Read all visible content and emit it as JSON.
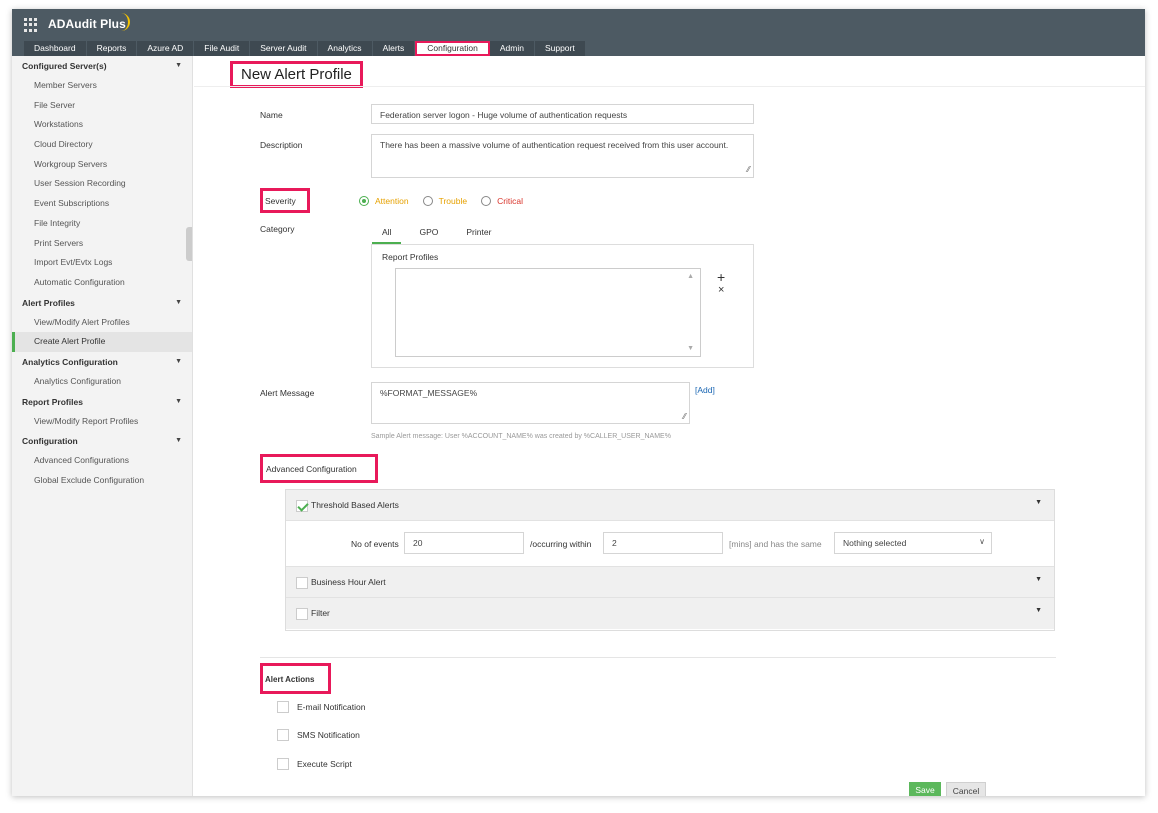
{
  "app": {
    "title": "ADAudit Plus"
  },
  "tabs": [
    "Dashboard",
    "Reports",
    "Azure AD",
    "File Audit",
    "Server Audit",
    "Analytics",
    "Alerts",
    "Configuration",
    "Admin",
    "Support"
  ],
  "active_tab": "Configuration",
  "sidebar": {
    "sections": [
      {
        "title": "Configured Server(s)",
        "items": [
          "Member Servers",
          "File Server",
          "Workstations",
          "Cloud Directory",
          "Workgroup Servers",
          "User Session Recording",
          "Event Subscriptions",
          "File Integrity",
          "Print Servers",
          "Import Evt/Evtx Logs",
          "Automatic Configuration"
        ]
      },
      {
        "title": "Alert Profiles",
        "items": [
          "View/Modify Alert Profiles",
          "Create Alert Profile"
        ]
      },
      {
        "title": "Analytics Configuration",
        "items": [
          "Analytics Configuration"
        ]
      },
      {
        "title": "Report Profiles",
        "items": [
          "View/Modify Report Profiles"
        ]
      },
      {
        "title": "Configuration",
        "items": [
          "Advanced Configurations",
          "Global Exclude Configuration"
        ]
      }
    ],
    "active_item": "Create Alert Profile"
  },
  "page": {
    "title": "New Alert Profile",
    "name_label": "Name",
    "name_value": "Federation server logon - Huge volume of authentication requests",
    "description_label": "Description",
    "description_value": "There has been a massive volume of authentication request received from this user account.",
    "severity_label": "Severity",
    "severity_options": [
      "Attention",
      "Trouble",
      "Critical"
    ],
    "severity_colors": [
      "#e6a100",
      "#e6a100",
      "#d9342b"
    ],
    "severity_selected": "Attention",
    "category_label": "Category",
    "category_tabs": [
      "All",
      "GPO",
      "Printer"
    ],
    "category_active": "All",
    "report_profiles_label": "Report Profiles",
    "add_symbol": "+",
    "remove_symbol": "×",
    "alert_message_label": "Alert Message",
    "alert_message_value": "%FORMAT_MESSAGE%",
    "add_link": "[Add]",
    "sample_message": "Sample Alert message: User %ACCOUNT_NAME% was created by %CALLER_USER_NAME%",
    "advanced_label": "Advanced Configuration",
    "threshold_label": "Threshold Based Alerts",
    "threshold_checked": true,
    "no_of_events_label": "No of events",
    "no_of_events_value": "20",
    "occurring_within_label": "/occurring within",
    "occurring_within_value": "2",
    "mins_label": "[mins] and has the same",
    "same_select_value": "Nothing selected",
    "business_hour_label": "Business Hour Alert",
    "filter_label": "Filter",
    "alert_actions_label": "Alert Actions",
    "actions": [
      "E-mail Notification",
      "SMS Notification",
      "Execute Script"
    ],
    "save_label": "Save",
    "cancel_label": "Cancel"
  },
  "colors": {
    "accent_green": "#4caf50",
    "highlight": "#e8195a",
    "topbar": "#4d5a63",
    "brand_arc": "#f5c400"
  }
}
